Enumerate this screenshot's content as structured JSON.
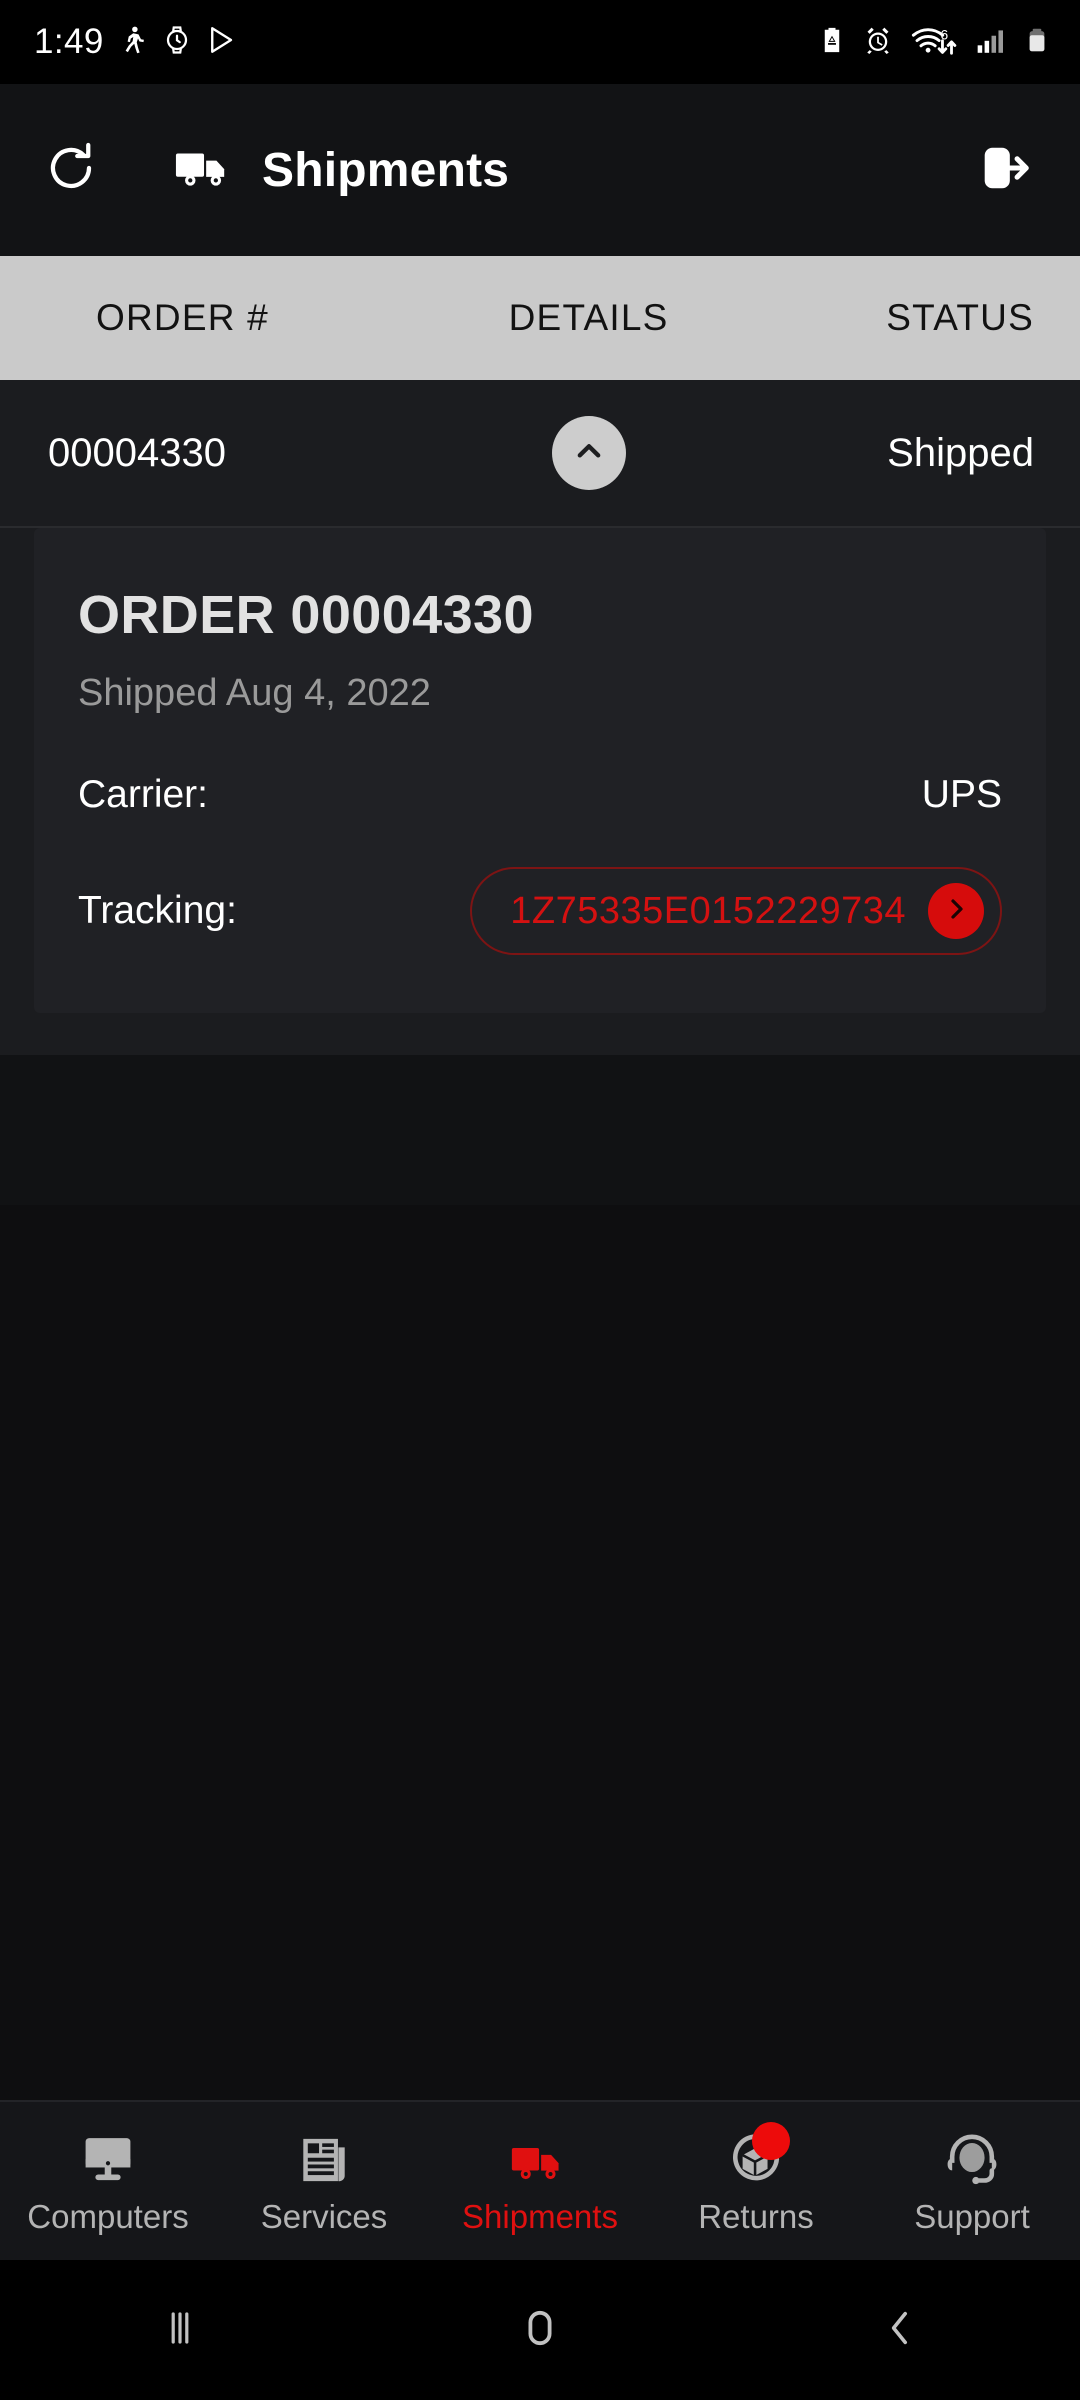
{
  "status_bar": {
    "time": "1:49",
    "left_icons": [
      "running-person-icon",
      "watch-alarm-icon",
      "play-store-icon"
    ],
    "right_icons": [
      "battery-saver-icon",
      "alarm-icon",
      "wifi6-transfer-icon",
      "signal-icon",
      "battery-icon"
    ]
  },
  "app_bar": {
    "refresh_icon": "refresh-icon",
    "truck_icon": "truck-icon",
    "title": "Shipments",
    "logout_icon": "logout-icon"
  },
  "table": {
    "columns": [
      "ORDER #",
      "DETAILS",
      "STATUS"
    ],
    "rows": [
      {
        "order_number": "00004330",
        "expand_icon": "chevron-up-icon",
        "status": "Shipped",
        "expanded": true
      }
    ]
  },
  "detail_card": {
    "title": "ORDER 00004330",
    "subtitle": "Shipped Aug 4, 2022",
    "fields": [
      {
        "key": "Carrier:",
        "value": "UPS"
      }
    ],
    "tracking": {
      "key": "Tracking:",
      "number": "1Z75335E0152229734",
      "go_icon": "chevron-right-icon"
    }
  },
  "bottom_nav": {
    "items": [
      {
        "label": "Computers",
        "icon": "monitor-icon",
        "active": false,
        "badge": false
      },
      {
        "label": "Services",
        "icon": "newspaper-icon",
        "active": false,
        "badge": false
      },
      {
        "label": "Shipments",
        "icon": "truck-icon",
        "active": true,
        "badge": false
      },
      {
        "label": "Returns",
        "icon": "return-box-icon",
        "active": false,
        "badge": true
      },
      {
        "label": "Support",
        "icon": "headset-icon",
        "active": false,
        "badge": false
      }
    ]
  },
  "android_nav": {
    "recents_icon": "recents-icon",
    "home_icon": "home-icon",
    "back_icon": "back-icon"
  },
  "colors": {
    "accent_red": "#e01010",
    "tracking_red": "#d41111",
    "header_bar": "#cacaca",
    "card_bg": "#202125",
    "page_bg": "#0e0e10"
  }
}
